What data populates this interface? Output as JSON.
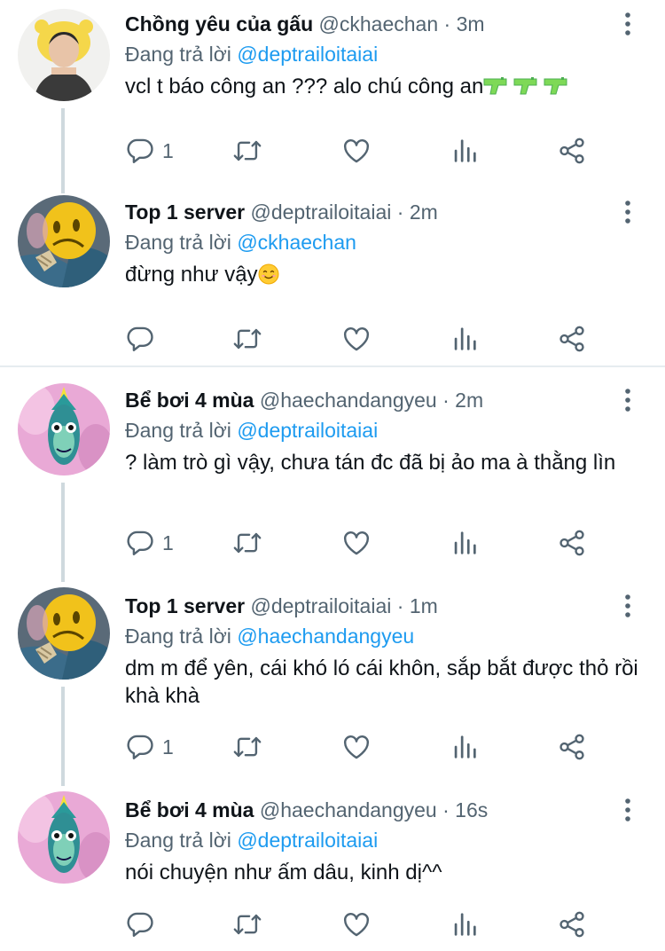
{
  "tweets": [
    {
      "name": "Chồng yêu của gấu",
      "handle": "@ckhaechan",
      "separator": "·",
      "time": "3m",
      "reply_prefix": "Đang trả lời",
      "reply_to": "@deptrailoitaiai",
      "text": "vcl t báo công an ??? alo chú công an",
      "reply_count": "1",
      "avatar": "person-avatar"
    },
    {
      "name": "Top 1 server",
      "handle": "@deptrailoitaiai",
      "separator": "·",
      "time": "2m",
      "reply_prefix": "Đang trả lời",
      "reply_to": "@ckhaechan",
      "text": "đừng như vậy",
      "reply_count": "",
      "avatar": "yellow-emoji-avatar"
    },
    {
      "name": "Bể bơi 4 mùa",
      "handle": "@haechandangyeu",
      "separator": "·",
      "time": "2m",
      "reply_prefix": "Đang trả lời",
      "reply_to": "@deptrailoitaiai",
      "text": "? làm trò gì vậy, chưa tán đc đã bị ảo ma à thằng lìn",
      "reply_count": "1",
      "avatar": "fish-avatar"
    },
    {
      "name": "Top 1 server",
      "handle": "@deptrailoitaiai",
      "separator": "·",
      "time": "1m",
      "reply_prefix": "Đang trả lời",
      "reply_to": "@haechandangyeu",
      "text": "dm m để yên, cái khó ló cái khôn, sắp bắt được thỏ rồi khà khà",
      "reply_count": "1",
      "avatar": "yellow-emoji-avatar"
    },
    {
      "name": "Bể bơi 4 mùa",
      "handle": "@haechandangyeu",
      "separator": "·",
      "time": "16s",
      "reply_prefix": "Đang trả lời",
      "reply_to": "@deptrailoitaiai",
      "text": "nói chuyện như ấm dâu, kinh dị^^",
      "reply_count": "",
      "avatar": "fish-avatar"
    }
  ],
  "icons": {
    "reply": "reply-icon",
    "retweet": "retweet-icon",
    "like": "heart-icon",
    "views": "views-icon",
    "share": "share-icon",
    "more": "more-icon",
    "tweet1_emoji": "water-pistol-emoji",
    "tweet2_emoji": "smiling-face-emoji"
  },
  "colors": {
    "link": "#1d9bf0",
    "secondary": "#536471",
    "thread_line": "#cfd9de",
    "divider": "#e6ecf0"
  }
}
